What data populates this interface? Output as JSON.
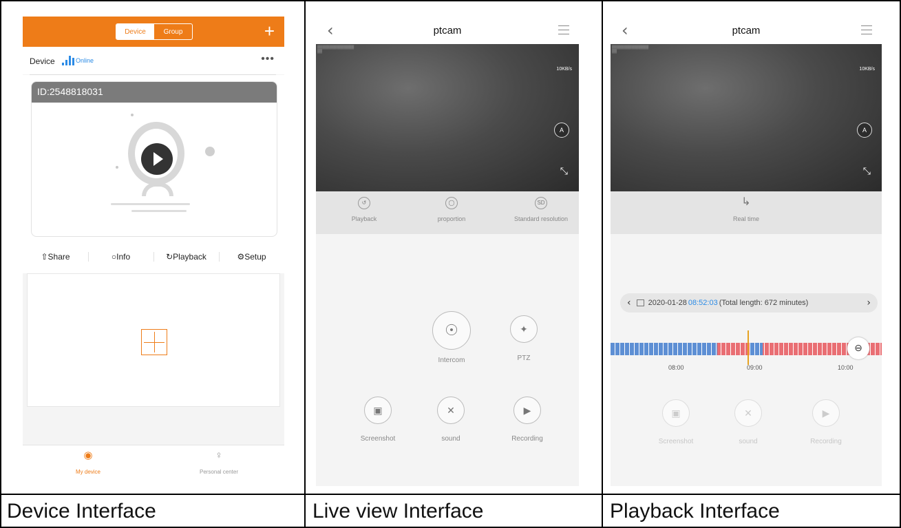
{
  "device": {
    "tabs": [
      "Device",
      "Group"
    ],
    "add_label": "+",
    "header_label": "Device",
    "status": "Online",
    "more_label": "•••",
    "device_id": "ID:2548818031",
    "actions": [
      {
        "label": "Share",
        "icon": "share-icon",
        "glyph": "⇧"
      },
      {
        "label": "Info",
        "icon": "bell-icon",
        "glyph": "○"
      },
      {
        "label": "Playback",
        "icon": "playback-icon",
        "glyph": "↻"
      },
      {
        "label": "Setup",
        "icon": "gear-icon",
        "glyph": "⚙"
      }
    ],
    "bottom_tabs": [
      {
        "label": "My device",
        "icon": "camera-icon",
        "glyph": "◉",
        "active": true
      },
      {
        "label": "Personal center",
        "icon": "person-icon",
        "glyph": "♀",
        "active": false
      }
    ],
    "accent": "#ee7c18"
  },
  "live": {
    "title": "ptcam",
    "back_glyph": "‹",
    "rate": "10KB/s",
    "auto_label": "A",
    "fullscreen_glyph": "⤡",
    "tools": [
      {
        "label": "Playback",
        "icon": "clock-icon",
        "glyph": "↺"
      },
      {
        "label": "proportion",
        "icon": "proportion-icon",
        "glyph": "◯"
      },
      {
        "label": "Standard resolution",
        "icon": "sd-icon",
        "glyph": "SD"
      }
    ],
    "controls": [
      {
        "label": "Intercom",
        "icon": "microphone-icon",
        "glyph": "☉"
      },
      {
        "label": "PTZ",
        "icon": "ptz-icon",
        "glyph": "✦"
      },
      {
        "label": "Screenshot",
        "icon": "camera-icon",
        "glyph": "▣"
      },
      {
        "label": "sound",
        "icon": "mute-icon",
        "glyph": "✕"
      },
      {
        "label": "Recording",
        "icon": "record-icon",
        "glyph": "▶"
      }
    ]
  },
  "playback": {
    "title": "ptcam",
    "back_glyph": "‹",
    "rate": "10KB/s",
    "auto_label": "A",
    "fullscreen_glyph": "⤡",
    "realtime_label": "Real time",
    "realtime_glyph": "↳",
    "date": "2020-01-28",
    "time": "08:52:03",
    "total": "(Total length: 672 minutes)",
    "prev_glyph": "‹",
    "next_glyph": "›",
    "zoom_glyph": "⊖",
    "timeline_labels": [
      "08:00",
      "09:00",
      "10:00"
    ],
    "controls": [
      {
        "label": "Screenshot",
        "icon": "camera-icon",
        "glyph": "▣"
      },
      {
        "label": "sound",
        "icon": "mute-icon",
        "glyph": "✕"
      },
      {
        "label": "Recording",
        "icon": "record-icon",
        "glyph": "▶"
      }
    ]
  },
  "captions": [
    "Device Interface",
    "Live view Interface",
    "Playback Interface"
  ]
}
